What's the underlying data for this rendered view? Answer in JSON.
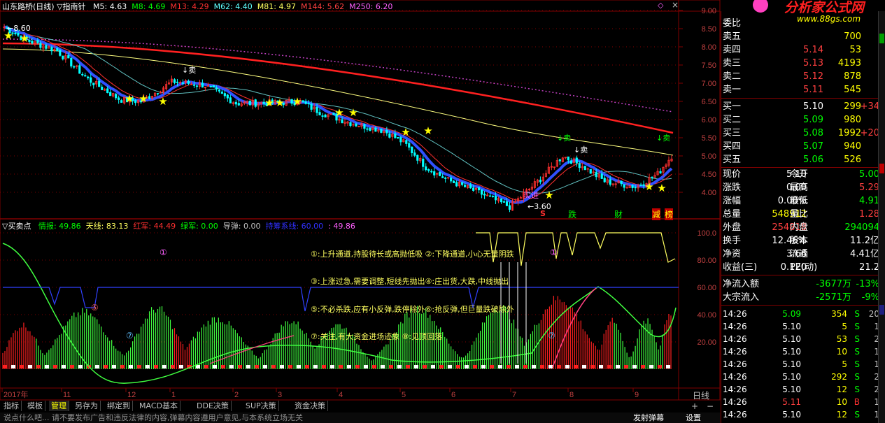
{
  "main_header": {
    "title": "山东路桥(日线) ▽指南针",
    "items": [
      {
        "text": "M5: 4.63",
        "color": "#ffffff"
      },
      {
        "text": "M8: 4.69",
        "color": "#00ff00"
      },
      {
        "text": "M13: 4.29",
        "color": "#ff3030"
      },
      {
        "text": "M62: 4.40",
        "color": "#60ffff"
      },
      {
        "text": "M81: 4.97",
        "color": "#ffff60"
      },
      {
        "text": "M144: 5.62",
        "color": "#ff4040"
      },
      {
        "text": "M250: 6.20",
        "color": "#ff60ff"
      }
    ]
  },
  "main_price_axis": [
    "9.00",
    "8.50",
    "8.00",
    "7.50",
    "7.00",
    "6.50",
    "6.00",
    "5.50",
    "5.00",
    "4.50",
    "4.00"
  ],
  "annotations": {
    "high_label": "8.60",
    "low_label": "3.60",
    "sell_1": "卖",
    "sell_2": "卖",
    "sell_3": "卖",
    "sell_4": "卖",
    "buy_label": "买进",
    "signal_s": "S",
    "signal_die": "跌",
    "signal_cai": "财",
    "signal_jian": "减",
    "signal_bang": "榜"
  },
  "sub_header": {
    "title": "▽买卖点",
    "items": [
      {
        "text": "情报: 49.86",
        "color": "#00ff00"
      },
      {
        "text": "天线: 83.13",
        "color": "#ffff60"
      },
      {
        "text": "红军: 44.49",
        "color": "#ff3030"
      },
      {
        "text": "绿军: 0.00",
        "color": "#00ff00"
      },
      {
        "text": "导弹: 0.00",
        "color": "#c0c0c0"
      },
      {
        "text": "持筹系线: 60.00",
        "color": "#3030ff"
      },
      {
        "text": ": 49.86",
        "color": "#ff60ff"
      }
    ]
  },
  "sub_axis": [
    "100.0",
    "80.00",
    "60.00",
    "40.00",
    "20.00"
  ],
  "legend_texts": [
    "①:上升通道,持股待长或高抛低吸 ②:下降通道,小心无量阴跌",
    "③:上涨过急,需要调整,短线先抛出④:庄出货,大跌,中线抛出",
    "⑤:不必杀跌,应有小反弹,跌停除外⑥:抢反弹,但巨量跌破除外",
    "⑦:关注,有大资金进场迹象        ⑧:见顶回落"
  ],
  "circle_markers": [
    "①",
    "①",
    "⑤",
    "⑦",
    "⑦"
  ],
  "date_axis": [
    "2017年",
    "11",
    "12",
    "1",
    "2",
    "3",
    "4",
    "5",
    "6",
    "7",
    "8",
    "9"
  ],
  "date_axis_right": "日线",
  "tabs": [
    "指标",
    "模板",
    "管理",
    "另存为",
    "绑定到",
    "MACD基本",
    "DDE决策",
    "SUP决策",
    "资金决策"
  ],
  "active_tab": "管理",
  "status_text": "说点什么吧...  请不要发布广告和违反法律的内容,弹幕内容遵用户意见,与本系统立场无关",
  "status_right": [
    "发射弹幕",
    "设置"
  ],
  "logo": {
    "brand": "分析家公式网",
    "url": "www.88gs.com"
  },
  "order_book": {
    "weibi_label": "委比",
    "sells": [
      {
        "label": "卖五",
        "price": "",
        "vol": "700"
      },
      {
        "label": "卖四",
        "price": "5.14",
        "vol": "53"
      },
      {
        "label": "卖三",
        "price": "5.13",
        "vol": "4193"
      },
      {
        "label": "卖二",
        "price": "5.12",
        "vol": "878"
      },
      {
        "label": "卖一",
        "price": "5.11",
        "vol": "545"
      }
    ],
    "buys": [
      {
        "label": "买一",
        "price": "5.10",
        "vol": "299",
        "chg": "+34"
      },
      {
        "label": "买二",
        "price": "5.09",
        "vol": "980",
        "chg": ""
      },
      {
        "label": "买三",
        "price": "5.08",
        "vol": "1992",
        "chg": "+20"
      },
      {
        "label": "买四",
        "price": "5.07",
        "vol": "940",
        "chg": ""
      },
      {
        "label": "买五",
        "price": "5.06",
        "vol": "526",
        "chg": ""
      }
    ]
  },
  "stats": [
    {
      "l1": "现价",
      "v1": "5.10",
      "l2": "今开",
      "v2": "5.00",
      "c1": "#ffffff",
      "c2": "#00ff00"
    },
    {
      "l1": "涨跌",
      "v1": "0.00",
      "l2": "最高",
      "v2": "5.29",
      "c1": "#ffffff",
      "c2": "#ff4040"
    },
    {
      "l1": "涨幅",
      "v1": "0.00%",
      "l2": "最低",
      "v2": "4.91",
      "c1": "#ffffff",
      "c2": "#00ff00"
    },
    {
      "l1": "总量",
      "v1": "548912",
      "l2": "量比",
      "v2": "1.28",
      "c1": "#ffff00",
      "c2": "#ff4040"
    },
    {
      "l1": "外盘",
      "v1": "254818",
      "l2": "内盘",
      "v2": "294094",
      "c1": "#ff4040",
      "c2": "#00ff00"
    },
    {
      "l1": "换手",
      "v1": "12.46%",
      "l2": "股本",
      "v2": "11.2亿",
      "c1": "#ffffff",
      "c2": "#ffffff"
    },
    {
      "l1": "净资",
      "v1": "3.66",
      "l2": "流通",
      "v2": "4.41亿",
      "c1": "#ffffff",
      "c2": "#ffffff"
    },
    {
      "l1": "收益(三)",
      "v1": "0.120",
      "l2": "PE(动)",
      "v2": "21.2",
      "c1": "#ffffff",
      "c2": "#ffffff"
    }
  ],
  "flows": [
    {
      "label": "净流入额",
      "value": "-3677万",
      "pct": "-13%"
    },
    {
      "label": "大宗流入",
      "value": "-2571万",
      "pct": "-9%"
    }
  ],
  "ticks": [
    {
      "time": "14:26",
      "price": "5.09",
      "vol": "354",
      "bs": "S",
      "n": "20",
      "pc": "#00ff00"
    },
    {
      "time": "14:26",
      "price": "5.10",
      "vol": "5",
      "bs": "S",
      "n": "1",
      "pc": "#ffffff"
    },
    {
      "time": "14:26",
      "price": "5.10",
      "vol": "53",
      "bs": "S",
      "n": "2",
      "pc": "#ffffff"
    },
    {
      "time": "14:26",
      "price": "5.10",
      "vol": "10",
      "bs": "S",
      "n": "1",
      "pc": "#ffffff"
    },
    {
      "time": "14:26",
      "price": "5.10",
      "vol": "5",
      "bs": "S",
      "n": "1",
      "pc": "#ffffff"
    },
    {
      "time": "14:26",
      "price": "5.10",
      "vol": "292",
      "bs": "S",
      "n": "2",
      "pc": "#ffffff"
    },
    {
      "time": "14:26",
      "price": "5.10",
      "vol": "12",
      "bs": "S",
      "n": "2",
      "pc": "#ffffff"
    },
    {
      "time": "14:26",
      "price": "5.11",
      "vol": "10",
      "bs": "B",
      "n": "1",
      "pc": "#ff4040"
    },
    {
      "time": "14:26",
      "price": "5.10",
      "vol": "12",
      "bs": "S",
      "n": "1",
      "pc": "#ffffff"
    }
  ],
  "colors": {
    "background": "#000000",
    "up": "#ff3030",
    "down": "#00ffff",
    "grid": "#800000",
    "axis_text": "#c04040"
  }
}
